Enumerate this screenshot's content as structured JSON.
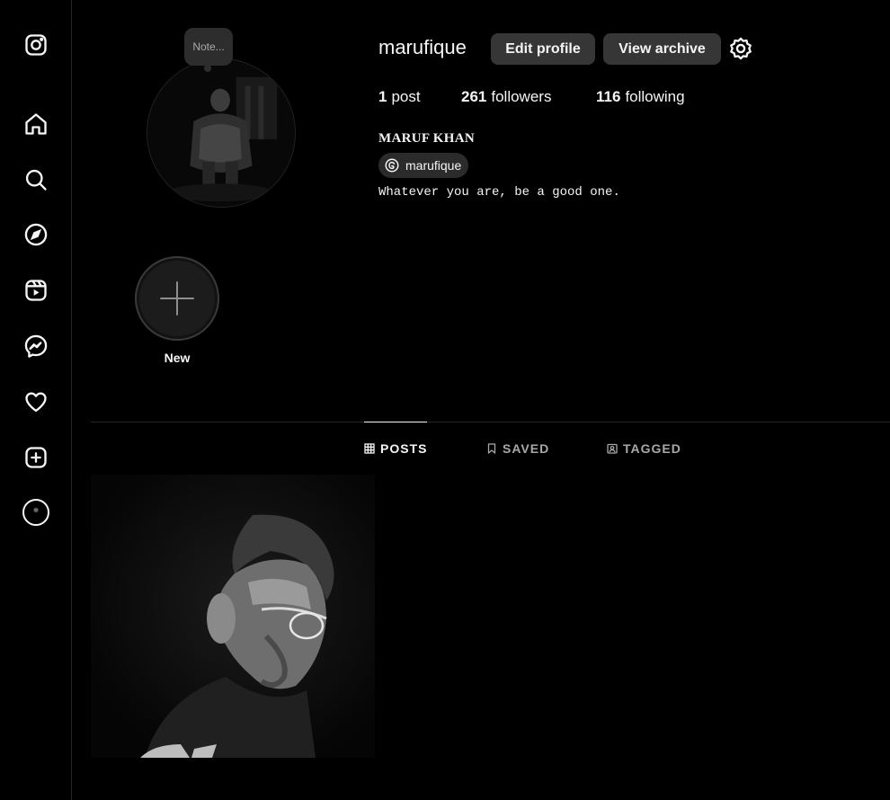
{
  "app": {
    "name": "Instagram"
  },
  "sidebar": {
    "items": [
      {
        "name": "instagram-logo-icon"
      },
      {
        "name": "home-icon"
      },
      {
        "name": "search-icon"
      },
      {
        "name": "explore-icon"
      },
      {
        "name": "reels-icon"
      },
      {
        "name": "messenger-icon"
      },
      {
        "name": "notifications-heart-icon"
      },
      {
        "name": "create-plus-icon"
      },
      {
        "name": "profile-avatar-icon"
      }
    ]
  },
  "profile": {
    "username": "marufique",
    "note_placeholder": "Note...",
    "edit_profile_label": "Edit profile",
    "view_archive_label": "View archive",
    "settings_icon": "gear-icon",
    "stats": {
      "posts_count": "1",
      "posts_label": "post",
      "followers_count": "261",
      "followers_label": "followers",
      "following_count": "116",
      "following_label": "following"
    },
    "full_name": "MARUF KHAN",
    "threads_handle": "marufique",
    "bio": "Whatever you are, be a good one."
  },
  "highlights": [
    {
      "label": "New"
    }
  ],
  "tabs": [
    {
      "label": "POSTS",
      "active": true
    },
    {
      "label": "SAVED",
      "active": false
    },
    {
      "label": "TAGGED",
      "active": false
    }
  ],
  "colors": {
    "background": "#000000",
    "button": "#363636",
    "text": "#f5f5f5",
    "muted": "#a8a8a8",
    "divider": "#262626"
  }
}
